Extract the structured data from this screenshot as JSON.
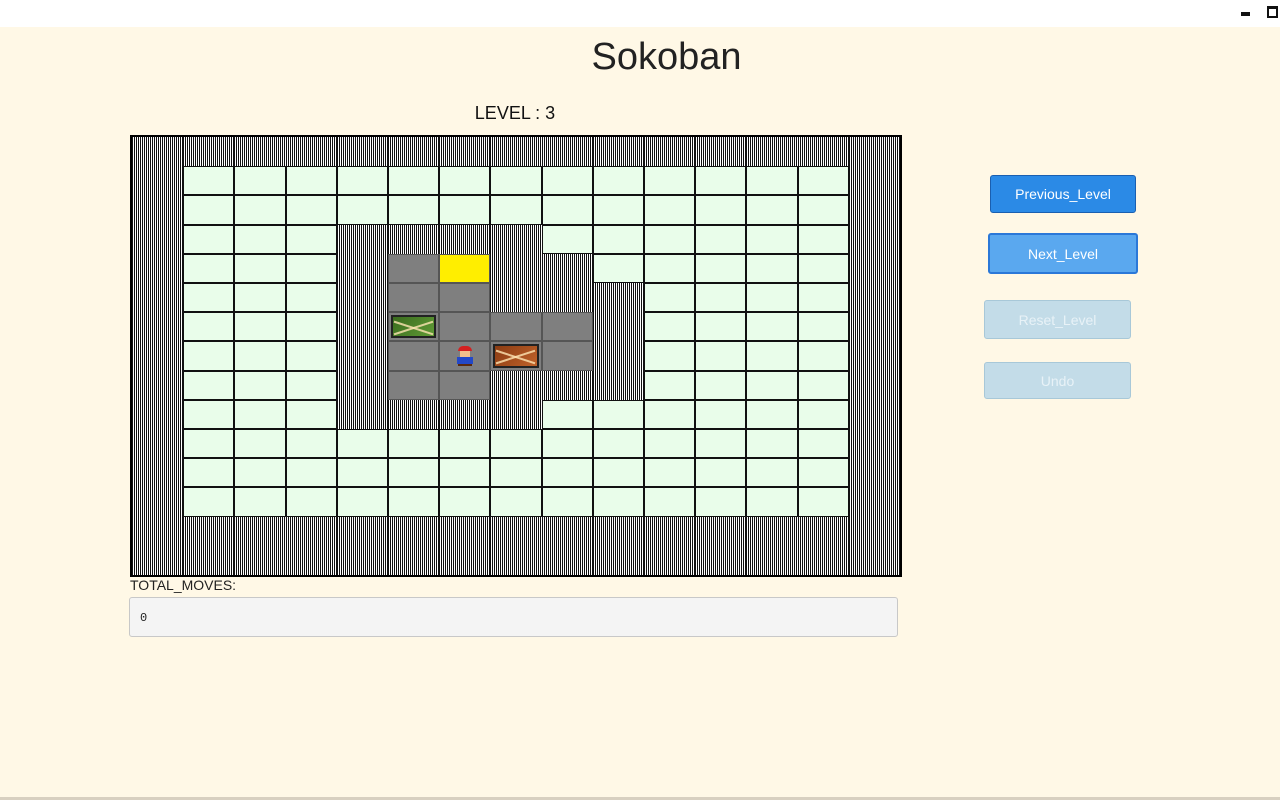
{
  "window": {
    "minimize_label": "minimize",
    "maximize_label": "maximize"
  },
  "app": {
    "title": "Sokoban",
    "level_label": "LEVEL : 3"
  },
  "board": {
    "rows": [
      "WWWWWWWWWWWWWWW",
      "WOOOOOOOOOOOOOW",
      "WOOOOOOOOOOOOOW",
      "WOOOWWWWOOOOOOW",
      "WOOOWFGWWOOOOOW",
      "WOOOWFFWWWOOOOW",
      "WOOOWCFFFWOOOOW",
      "WOOOWFPBFWOOOOW",
      "WOOOWFFWWWOOOOW",
      "WOOOWWWWOOOOOOW",
      "WOOOOOOOOOOOOOW",
      "WOOOOOOOOOOOOOW",
      "WOOOOOOOOOOOOOW",
      "WWWWWWWWWWWWWWW",
      "WWWWWWWWWWWWWWW"
    ],
    "legend": {
      "W": "wall",
      "O": "outside",
      "F": "floor",
      "G": "goal",
      "C": "crate-on-goal",
      "B": "crate",
      "P": "player"
    },
    "colors": {
      "goal": "#ffee00",
      "floor": "#7f7f7f",
      "outside": "#e9fdea"
    }
  },
  "moves": {
    "label": "TOTAL_MOVES:",
    "value": "0"
  },
  "controls": {
    "previous_label": "Previous_Level",
    "next_label": "Next_Level",
    "reset_label": "Reset_Level",
    "undo_label": "Undo"
  }
}
